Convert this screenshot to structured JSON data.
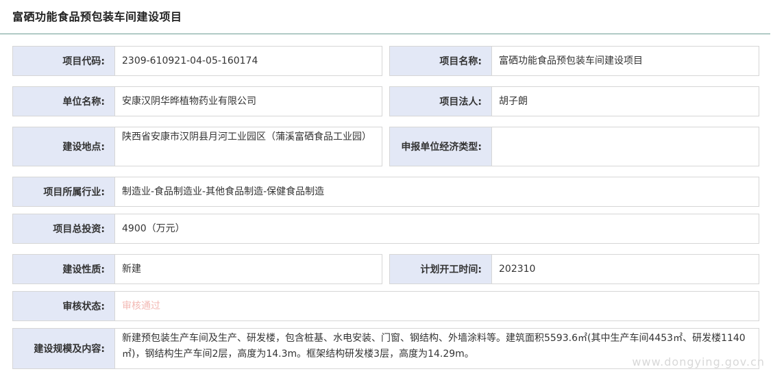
{
  "header": {
    "title": "富硒功能食品预包装车间建设项目"
  },
  "fields": {
    "project_code": {
      "label": "项目代码:",
      "value": "2309-610921-04-05-160174"
    },
    "project_name": {
      "label": "项目名称:",
      "value": "富硒功能食品预包装车间建设项目"
    },
    "unit_name": {
      "label": "单位名称:",
      "value": "安康汉阴华晔植物药业有限公司"
    },
    "legal_person": {
      "label": "项目法人:",
      "value": "胡子朗"
    },
    "location": {
      "label": "建设地点:",
      "value": "陕西省安康市汉阴县月河工业园区（蒲溪富硒食品工业园）"
    },
    "economic_type": {
      "label": "申报单位经济类型:",
      "value": ""
    },
    "industry": {
      "label": "项目所属行业:",
      "value": "制造业-食品制造业-其他食品制造-保健食品制造"
    },
    "total_investment": {
      "label": "项目总投资:",
      "value": "4900（万元）"
    },
    "nature": {
      "label": "建设性质:",
      "value": "新建"
    },
    "start_time": {
      "label": "计划开工时间:",
      "value": "202310"
    },
    "review_status": {
      "label": "审核状态:",
      "value": "审核通过"
    },
    "scale": {
      "label": "建设规模及内容:",
      "value": "新建预包装生产车间及生产、研发楼，包含桩基、水电安装、门窗、钢结构、外墙涂料等。建筑面积5593.6㎡(其中生产车间4453㎡、研发楼1140㎡)，钢结构生产车间2层，高度为14.3m。框架结构研发楼3层，高度为14.29m。"
    }
  },
  "colors": {
    "label_bg": "#e3e8f6",
    "border": "#d6d6d6",
    "header_rule": "#6d9c93",
    "status_text": "#f3b9b4"
  },
  "watermark": "www.dongying.gov.cn"
}
